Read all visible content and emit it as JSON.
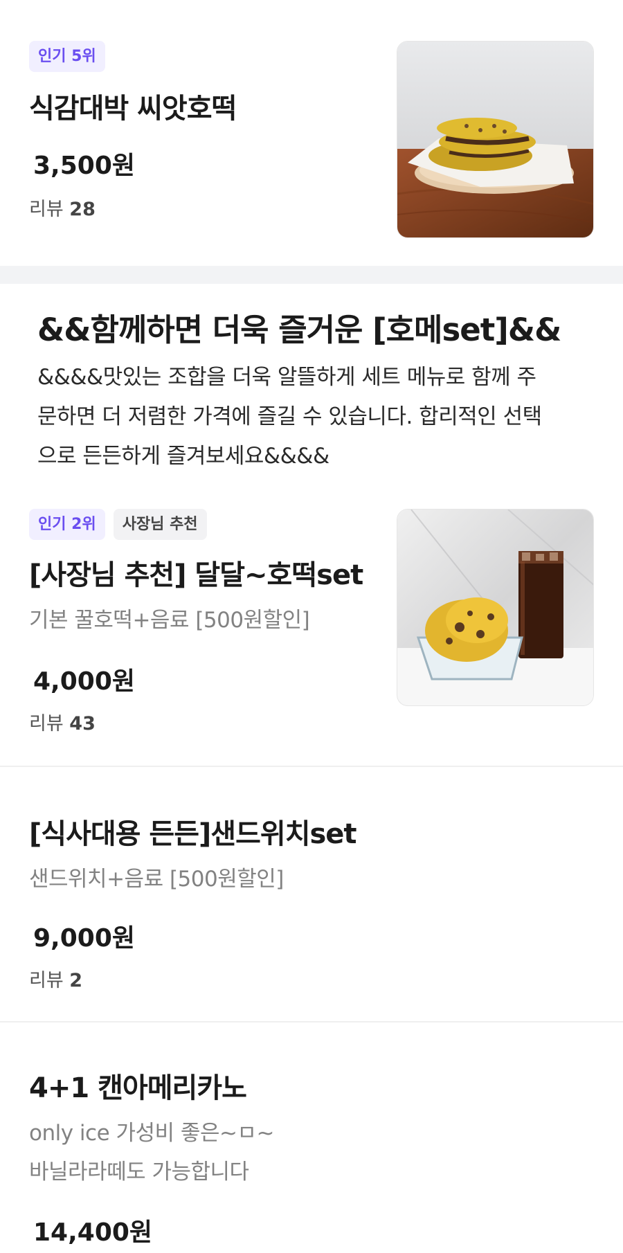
{
  "items": [
    {
      "badges": [
        "인기 5위"
      ],
      "name": "식감대박 씨앗호떡",
      "price": "3,500원",
      "review_label": "리뷰",
      "review_count": "28",
      "image_icon": "hotteok-photo-icon"
    },
    {
      "badges": [
        "인기 2위",
        "사장님 추천"
      ],
      "name": "[사장님 추천] 달달~호떡set",
      "desc": "기본 꿀호떡+음료 [500원할인]",
      "price": "4,000원",
      "review_label": "리뷰",
      "review_count": "43",
      "image_icon": "hotteok-drink-photo-icon"
    },
    {
      "name": "[식사대용 든든]샌드위치set",
      "desc": "샌드위치+음료 [500원할인]",
      "price": "9,000원",
      "review_label": "리뷰",
      "review_count": "2"
    },
    {
      "name": "4+1 캔아메리카노",
      "desc_line1": "only ice 가성비 좋은~ㅁ~",
      "desc_line2": "바닐라라떼도 가능합니다",
      "price": "14,400원"
    }
  ],
  "set_section": {
    "title": "&&함께하면 더욱 즐거운 [호메set]&&",
    "desc_line1": "&&&&맛있는 조합을 더욱 알뜰하게 세트 메뉴로 함께 주",
    "desc_line2": "문하면 더 저렴한 가격에 즐길 수 있습니다. 합리적인 선택",
    "desc_line3": "으로 든든하게 즐겨보세요&&&&"
  }
}
